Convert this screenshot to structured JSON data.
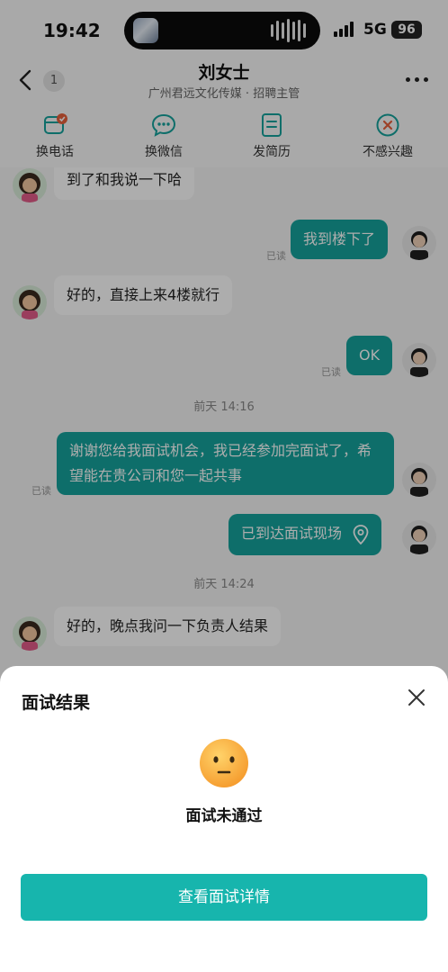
{
  "status_bar": {
    "time": "19:42",
    "network": "5G",
    "battery": "96"
  },
  "header": {
    "unread_count": "1",
    "name": "刘女士",
    "subtitle": "广州君远文化传媒 · 招聘主管"
  },
  "actions": [
    {
      "label": "换电话",
      "icon": "phone-swap-icon"
    },
    {
      "label": "换微信",
      "icon": "wechat-icon"
    },
    {
      "label": "发简历",
      "icon": "resume-icon"
    },
    {
      "label": "不感兴趣",
      "icon": "not-interested-icon"
    }
  ],
  "messages": {
    "m1": "到了和我说一下哈",
    "m2": "我到楼下了",
    "m2_status": "已读",
    "m3": "好的，直接上来4楼就行",
    "m4": "OK",
    "m4_status": "已读",
    "time1": "前天 14:16",
    "m5": "谢谢您给我面试机会，我已经参加完面试了，希望能在贵公司和您一起共事",
    "m5_status": "已读",
    "m6": "已到达面试现场",
    "time2": "前天 14:24",
    "m7": "好的，晚点我问一下负责人结果"
  },
  "sheet": {
    "title": "面试结果",
    "result": "面试未通过",
    "button": "查看面试详情"
  },
  "colors": {
    "accent": "#17b5ad",
    "bubble_sent": "#15a39c"
  }
}
